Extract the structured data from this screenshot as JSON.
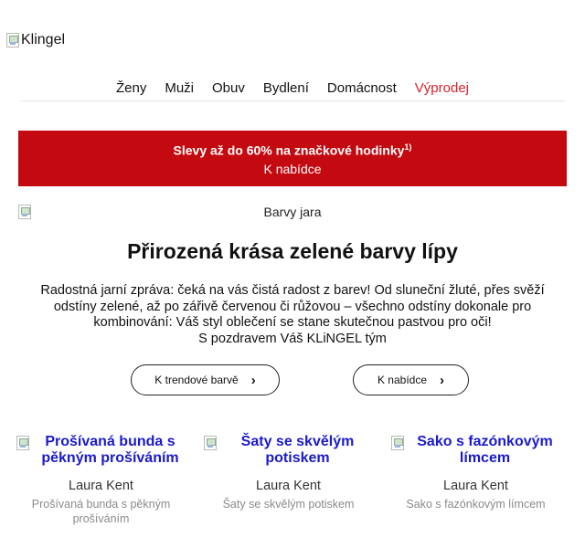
{
  "header": {
    "logo_alt": "Klingel"
  },
  "nav": {
    "items": [
      {
        "label": "Ženy"
      },
      {
        "label": "Muži"
      },
      {
        "label": "Obuv"
      },
      {
        "label": "Bydlení"
      },
      {
        "label": "Domácnost"
      },
      {
        "label": "Výprodej",
        "color": "#d6212b"
      }
    ]
  },
  "banner": {
    "title": "Slevy až do 60% na značkové hodinky",
    "footnote": "1)",
    "link_label": "K nabídce",
    "background": "#c30a10"
  },
  "hero": {
    "image_alt": "Barvy jara",
    "headline": "Přirozená krása zelené barvy lípy",
    "body": "Radostná jarní zpráva: čeká na vás čistá radost z barev! Od sluneční žluté, přes svěží odstíny zelené, až po zářivě červenou či růžovou – všechno odstíny dokonale pro kombinování: Váš styl oblečení se stane skutečnou pastvou pro oči!",
    "signature": "S pozdravem Váš KLiNGEL tým"
  },
  "buttons": {
    "trend_label": "K trendové barvě",
    "offer_label": "K nabídce",
    "chevron": "›"
  },
  "products": [
    {
      "title": "Prošívaná bunda s pěkným prošíváním",
      "brand": "Laura Kent",
      "desc": "Prošívaná bunda s pěkným prošíváním"
    },
    {
      "title": "Šaty se skvělým potiskem",
      "brand": "Laura Kent",
      "desc": "Šaty se skvělým potiskem"
    },
    {
      "title": "Sako s fazónkovým límcem",
      "brand": "Laura Kent",
      "desc": "Sako s fazónkovým límcem"
    }
  ]
}
